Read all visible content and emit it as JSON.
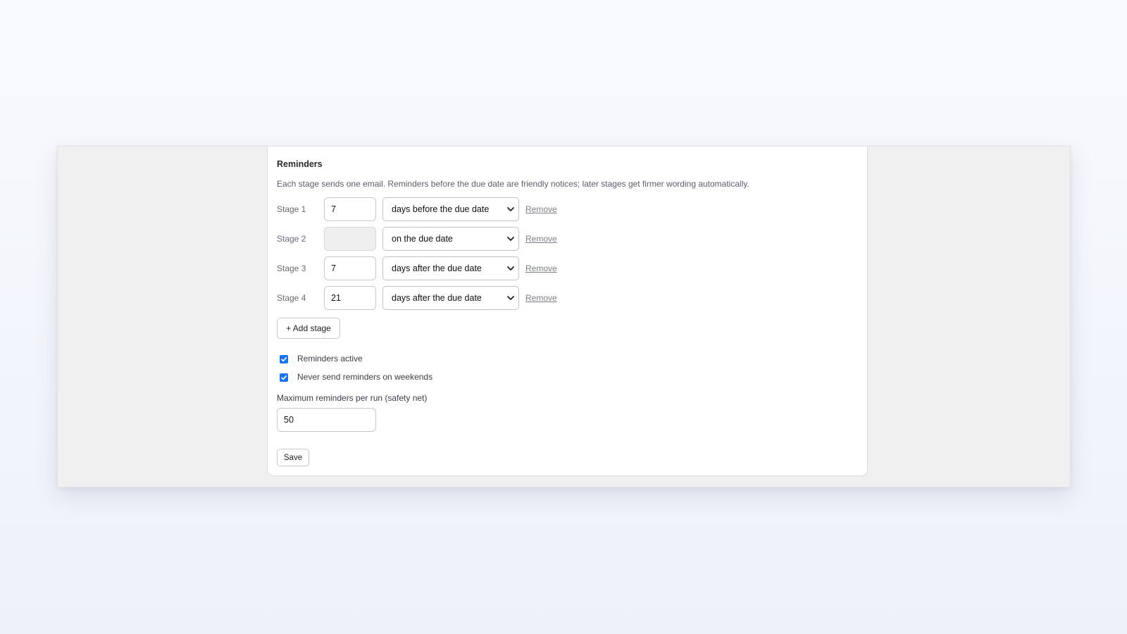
{
  "reminders": {
    "title": "Reminders",
    "description": "Each stage sends one email. Reminders before the due date are friendly notices; later stages get firmer wording automatically.",
    "remove_label": "Remove",
    "stages": [
      {
        "label": "Stage 1",
        "days": "7",
        "days_enabled": true,
        "timing": "days before the due date"
      },
      {
        "label": "Stage 2",
        "days": "",
        "days_enabled": false,
        "timing": "on the due date"
      },
      {
        "label": "Stage 3",
        "days": "7",
        "days_enabled": true,
        "timing": "days after the due date"
      },
      {
        "label": "Stage 4",
        "days": "21",
        "days_enabled": true,
        "timing": "days after the due date"
      }
    ],
    "add_stage_label": "+ Add stage",
    "options": {
      "reminders_active": {
        "label": "Reminders active",
        "checked": true
      },
      "skip_weekends": {
        "label": "Never send reminders on weekends",
        "checked": true
      }
    },
    "max_per_run": {
      "label": "Maximum reminders per run (safety net)",
      "value": "50"
    },
    "save_label": "Save"
  },
  "colors": {
    "accent": "#1a73e8",
    "page_background": "#f0f0f0",
    "card_background": "#ffffff",
    "muted_text": "#5a5e6a"
  },
  "icons": {
    "select_arrow": "chevron-down-icon",
    "checkbox_mark": "checkmark-icon"
  }
}
